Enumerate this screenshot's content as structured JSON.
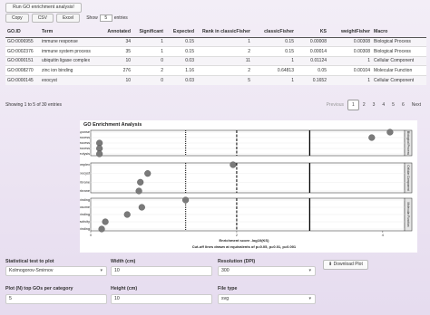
{
  "run_button": "Run GO enrichment analysis!",
  "toolbar": {
    "copy": "Copy",
    "csv": "CSV",
    "excel": "Excel",
    "show": "Show",
    "show_value": "5",
    "entries": "entries"
  },
  "table": {
    "headers": [
      "GO.ID",
      "Term",
      "Annotated",
      "Significant",
      "Expected",
      "Rank in classicFisher",
      "classicFisher",
      "KS",
      "weightFisher",
      "Macro"
    ],
    "rows": [
      [
        "GO:0006955",
        "immune response",
        "34",
        "1",
        "0.15",
        "1",
        "0.15",
        "0.00008",
        "0.00308",
        "Biological Process"
      ],
      [
        "GO:0002376",
        "immune system process",
        "35",
        "1",
        "0.15",
        "2",
        "0.15",
        "0.00014",
        "0.00308",
        "Biological Process"
      ],
      [
        "GO:0000151",
        "ubiquitin ligase complex",
        "10",
        "0",
        "0.03",
        "11",
        "1",
        "0.01124",
        "1",
        "Cellular Component"
      ],
      [
        "GO:0008270",
        "zinc ion binding",
        "276",
        "2",
        "1.16",
        "2",
        "0.64813",
        "0.05",
        "0.00104",
        "Molecular Function"
      ],
      [
        "GO:0000145",
        "exocyst",
        "10",
        "0",
        "0.03",
        "5",
        "1",
        "0.1652",
        "1",
        "Cellular Component"
      ]
    ]
  },
  "info": "Showing 1 to 5 of 30 entries",
  "pagination": {
    "previous": "Previous",
    "pages": [
      "1",
      "2",
      "3",
      "4",
      "5",
      "6"
    ],
    "next": "Next",
    "active": "1"
  },
  "chart_data": {
    "type": "scatter",
    "title": "GO Enrichment Analysis",
    "xlabel": "Enrichment score -log10(KS)",
    "caption": "Cut-off lines drawn at equivalents of p=0.05, p=0.01, p=0.001",
    "xlim": [
      0,
      4.3
    ],
    "x_ticks": [
      "0",
      "2",
      "4"
    ],
    "cutoffs": [
      1.301,
      2,
      3
    ],
    "point_color": "#7a7a7a",
    "facets": [
      {
        "name": "Biological Process",
        "terms": [
          "immune response",
          "immune system process",
          "lipid metabolic process",
          "biological_process",
          "proteolysis"
        ],
        "values": [
          4.1,
          3.85,
          0.12,
          0.12,
          0.12
        ]
      },
      {
        "name": "Cellular Component",
        "terms": [
          "ubiquitin ligase complex",
          "exocyst",
          "integral component of membrane",
          "intrinsic component of membrane"
        ],
        "values": [
          1.95,
          0.78,
          0.68,
          0.66
        ]
      },
      {
        "name": "Molecular Function",
        "terms": [
          "zinc ion binding",
          "structural constituent of ribosome",
          "actin binding",
          "lysozyme activity",
          "calcium ion binding"
        ],
        "values": [
          1.3,
          0.7,
          0.5,
          0.2,
          0.15
        ]
      }
    ]
  },
  "form": {
    "stat_label": "Statistical test to plot",
    "stat_value": "Kolmogorov-Smirnov",
    "topgo_label": "Plot (N) top GOs per category",
    "topgo_value": "5",
    "width_label": "Width (cm)",
    "width_value": "10",
    "height_label": "Height (cm)",
    "height_value": "10",
    "res_label": "Resolution (DPI)",
    "res_value": "300",
    "filetype_label": "File type",
    "filetype_value": "svg",
    "download_label": "Download Plot"
  }
}
